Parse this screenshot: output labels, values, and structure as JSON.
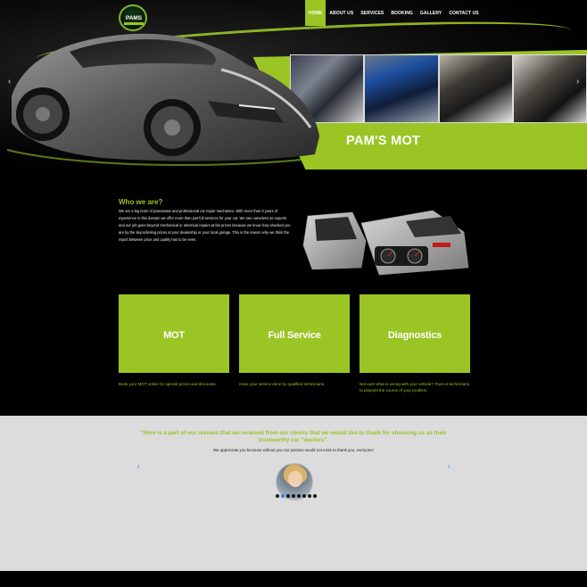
{
  "brand": {
    "logo_text": "PAMS",
    "banner": "PAM'S MOT"
  },
  "nav": {
    "items": [
      {
        "label": "HOME",
        "active": true
      },
      {
        "label": "ABOUT US",
        "active": false
      },
      {
        "label": "SERVICES",
        "active": false
      },
      {
        "label": "BOOKING",
        "active": false
      },
      {
        "label": "GALLERY",
        "active": false
      },
      {
        "label": "CONTACT US",
        "active": false
      }
    ]
  },
  "slider": {
    "prev_icon": "‹",
    "next_icon": "›"
  },
  "about": {
    "title": "Who we are?",
    "body": "We are a big team of passionate and professional car repair mechanics. With more than 9 years of experience in this domain we offer more than just full services for your car. We see ourselves as experts and our job goes beyond mechanical or electrical repairs at fair prices because we know how shocked you are by the skyrocketing prices at your dealership or your local garage. This is the reason why we think the report between price and quality has to be even."
  },
  "services": [
    {
      "title": "MOT",
      "desc": "Book your MOT online for special prices and discounts."
    },
    {
      "title": "Full Service",
      "desc": "Have your service done by qualified technicians."
    },
    {
      "title": "Diagnostics",
      "desc": "Not sure what is wrong with your vehicle? Trust or technicians to pinpoint the source of your problem."
    }
  ],
  "reviews": {
    "title": "\"Here is a part of our reviews that we received from our clients that we would like to thank for choosing us as their trustworthy car \"doctors\".",
    "subtitle": "We appreciate you because without you our passion would not exist so thank you, everyone!",
    "prev_icon": "‹",
    "next_icon": "›",
    "dots_count": 8,
    "active_dot": 1
  },
  "colors": {
    "accent": "#9bc425",
    "background": "#000000",
    "reviews_bg": "#dcdcdc",
    "link_blue": "#3a7bd5"
  }
}
